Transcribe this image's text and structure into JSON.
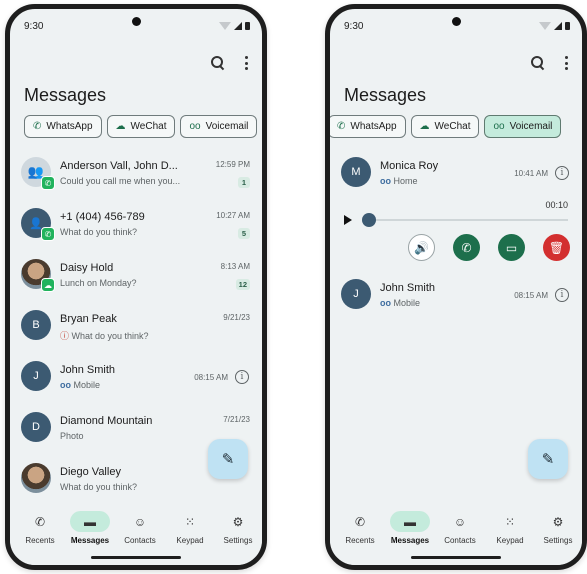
{
  "left": {
    "status_time": "9:30",
    "title": "Messages",
    "chips": [
      {
        "icon": "whatsapp-icon",
        "glyph": "✆",
        "label": "WhatsApp"
      },
      {
        "icon": "wechat-icon",
        "glyph": "☁",
        "label": "WeChat"
      },
      {
        "icon": "voicemail-icon",
        "glyph": "oo",
        "label": "Voicemail"
      }
    ],
    "conversations": [
      {
        "name": "Anderson Vall, John D...",
        "preview": "Could you call me when you...",
        "time": "12:59 PM",
        "count": "1",
        "avatar": "group"
      },
      {
        "name": "+1 (404) 456-789",
        "preview": "What do you think?",
        "time": "10:27 AM",
        "count": "5",
        "avatar": "person"
      },
      {
        "name": "Daisy Hold",
        "preview": "Lunch on Monday?",
        "time": "8:13 AM",
        "count": "12",
        "avatar": "photo"
      },
      {
        "name": "Bryan Peak",
        "preview": "What do you think?",
        "time": "9/21/23",
        "avatar_letter": "B"
      },
      {
        "name": "John Smith",
        "preview": "Mobile",
        "time": "08:15 AM",
        "avatar_letter": "J"
      },
      {
        "name": "Diamond Mountain",
        "preview": "Photo",
        "time": "7/21/23",
        "avatar_letter": "D"
      },
      {
        "name": "Diego Valley",
        "preview": "What do you think?",
        "avatar": "photo"
      }
    ]
  },
  "right": {
    "status_time": "9:30",
    "title": "Messages",
    "chips": [
      {
        "icon": "whatsapp-icon",
        "glyph": "✆",
        "label": "WhatsApp"
      },
      {
        "icon": "wechat-icon",
        "glyph": "☁",
        "label": "WeChat"
      },
      {
        "icon": "voicemail-icon",
        "glyph": "oo",
        "label": "Voicemail",
        "selected": true
      }
    ],
    "voicemails": [
      {
        "name": "Monica Roy",
        "type": "Home",
        "time": "10:41 AM",
        "avatar_letter": "M",
        "duration": "00:10",
        "progress": 0.0
      },
      {
        "name": "John Smith",
        "type": "Mobile",
        "time": "08:15 AM",
        "avatar_letter": "J"
      }
    ]
  },
  "nav": [
    {
      "icon": "phone-icon",
      "glyph": "✆",
      "label": "Recents"
    },
    {
      "icon": "chat-icon",
      "glyph": "▬",
      "label": "Messages",
      "active": true
    },
    {
      "icon": "contacts-icon",
      "glyph": "☺",
      "label": "Contacts"
    },
    {
      "icon": "keypad-icon",
      "glyph": "⁙",
      "label": "Keypad"
    },
    {
      "icon": "settings-icon",
      "glyph": "⚙",
      "label": "Settings"
    }
  ],
  "colors": {
    "accent_green": "#1d6f4c",
    "chip_selected": "#c4ebdc",
    "avatar_blue": "#3c5a72",
    "delete_red": "#d32f2f",
    "fab_blue": "#bfe2f3"
  }
}
